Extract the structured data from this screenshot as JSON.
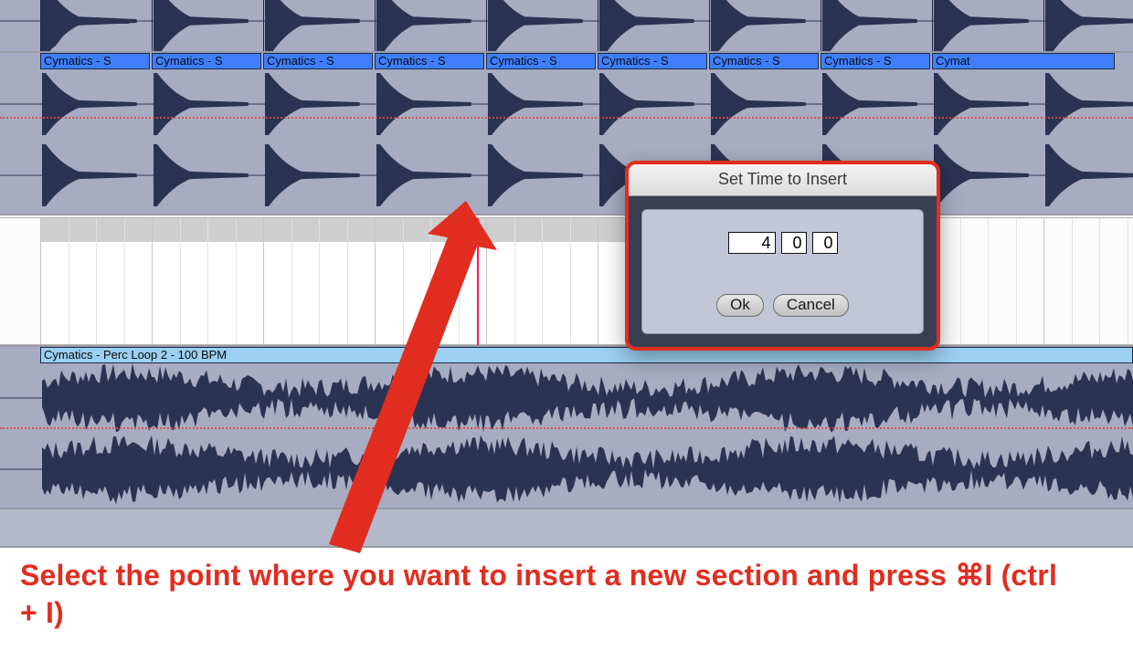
{
  "tracks": {
    "track1": {
      "clip_segment_label": "Cymatics - S",
      "clip_segment_label_last": "Cymat"
    },
    "track3": {
      "clip_label": "Cymatics - Perc Loop 2 - 100 BPM"
    }
  },
  "dialog": {
    "title": "Set Time to Insert",
    "bars": "4",
    "beats": "0",
    "ticks": "0",
    "ok_label": "Ok",
    "cancel_label": "Cancel"
  },
  "annotation": {
    "caption": "Select the point where you want to insert a new section and press ⌘I (ctrl + I)"
  },
  "colors": {
    "accent_red": "#e12d1f",
    "clip_blue": "#3f7fff",
    "clip_lightblue": "#9bd0f2",
    "wave_navy": "#2b3352"
  }
}
